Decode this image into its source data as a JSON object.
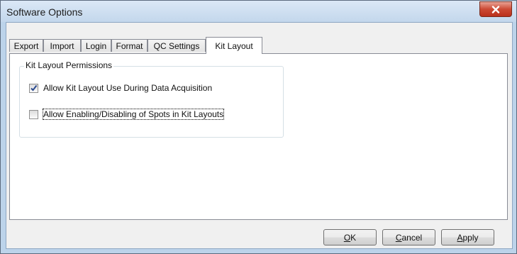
{
  "window": {
    "title": "Software Options"
  },
  "tabs": [
    {
      "label": "Export"
    },
    {
      "label": "Import"
    },
    {
      "label": "Login"
    },
    {
      "label": "Format"
    },
    {
      "label": "QC Settings"
    },
    {
      "label": "Kit Layout",
      "active": true
    }
  ],
  "group": {
    "title": "Kit Layout Permissions",
    "options": [
      {
        "label": "Allow Kit Layout Use During Data Acquisition",
        "checked": true
      },
      {
        "label": "Allow Enabling/Disabling of Spots in Kit Layouts",
        "checked": false
      }
    ]
  },
  "buttons": {
    "ok": {
      "mnemonic": "O",
      "rest": "K"
    },
    "cancel": {
      "mnemonic": "C",
      "rest": "ancel"
    },
    "apply": {
      "mnemonic": "A",
      "rest": "pply"
    }
  },
  "colors": {
    "title_bar": "#c3d7ec",
    "close_button": "#cc4a34",
    "dialog_bg": "#f0f0f0"
  },
  "icons": {
    "close": "close-icon",
    "check": "checkmark-icon"
  }
}
